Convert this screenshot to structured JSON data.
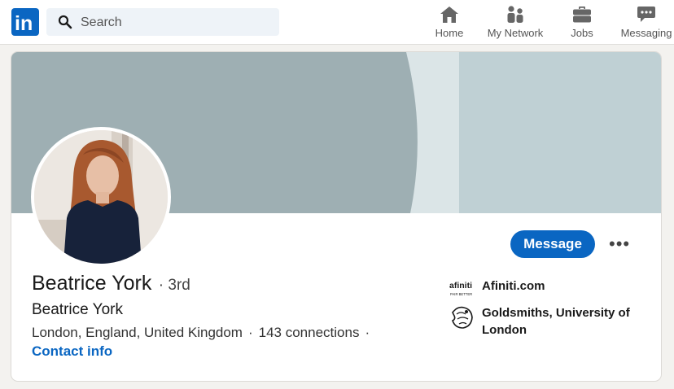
{
  "topbar": {
    "logo_text": "in",
    "search": {
      "placeholder": "Search",
      "value": ""
    },
    "nav": [
      {
        "label": "Home",
        "icon": "home-icon"
      },
      {
        "label": "My Network",
        "icon": "my-network-icon"
      },
      {
        "label": "Jobs",
        "icon": "briefcase-icon"
      },
      {
        "label": "Messaging",
        "icon": "messaging-icon"
      }
    ]
  },
  "profile": {
    "name": "Beatrice York",
    "degree": "3rd",
    "headline": "Beatrice York",
    "location": "London, England, United Kingdom",
    "connections": "143 connections",
    "contact_label": "Contact info",
    "message_label": "Message",
    "more_label": "•••"
  },
  "orgs": [
    {
      "name": "Afiniti.com",
      "logo_text": "afiniti",
      "logo_subtext": "PAIR BETTER",
      "icon": "afiniti-logo"
    },
    {
      "name": "Goldsmiths, University of London",
      "icon": "goldsmiths-logo"
    }
  ],
  "colors": {
    "brand": "#0a66c2",
    "banner_dark": "#9eafb3",
    "banner_light": "#bfd0d4",
    "banner_pale": "#dbe5e7",
    "page_bg": "#f3f2ef"
  }
}
